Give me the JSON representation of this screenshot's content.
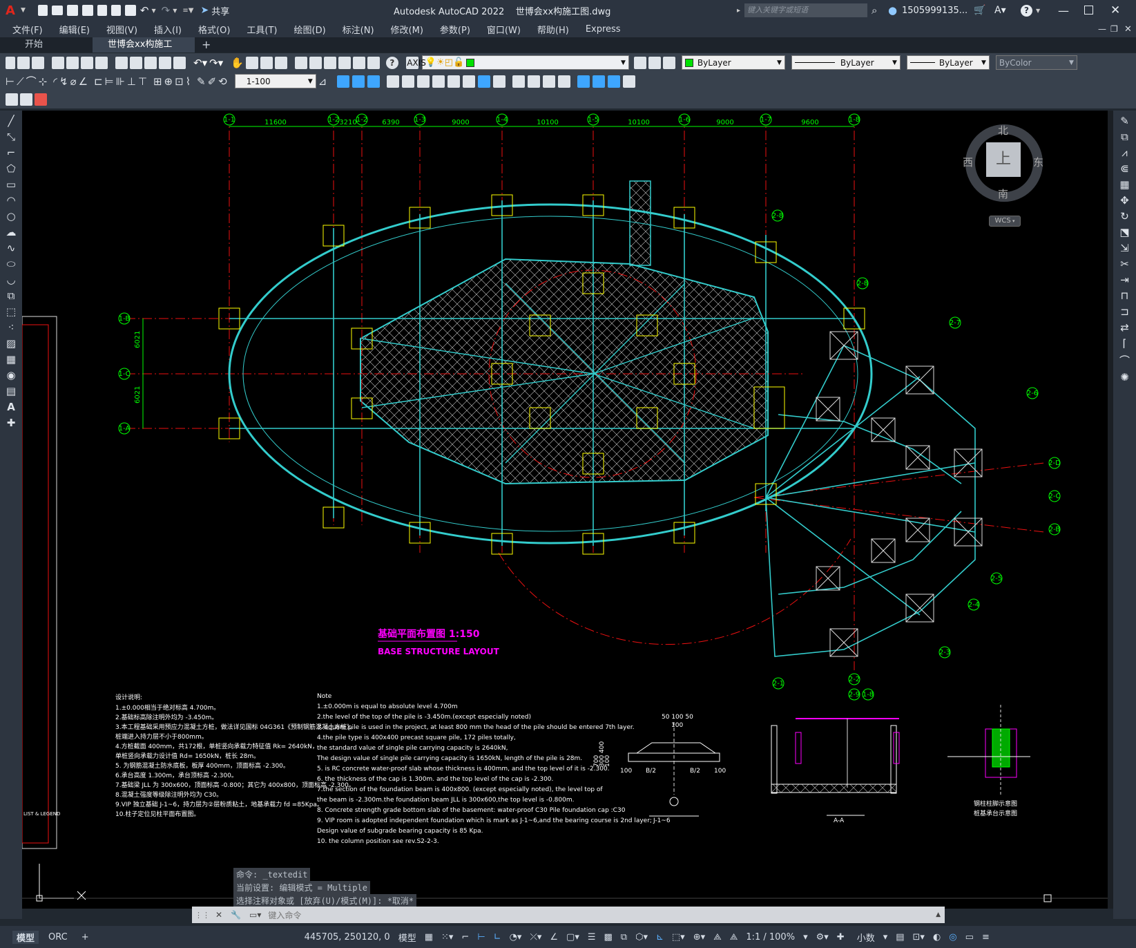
{
  "titlebar": {
    "logo": "A",
    "share_label": "共享",
    "title": "Autodesk AutoCAD 2022    世博会xx构施工图.dwg",
    "search_placeholder": "键入关键字或短语",
    "user": "1505999135...",
    "icons": [
      "new-icon",
      "open-icon",
      "save-icon",
      "saveas-icon",
      "publish-icon",
      "plot-icon",
      "undo-icon",
      "redo-icon",
      "share-icon",
      "search-icon",
      "user-icon",
      "cart-icon",
      "help-icon",
      "minimize-icon",
      "maximize-icon",
      "close-icon"
    ]
  },
  "menu": {
    "items": [
      "文件(F)",
      "编辑(E)",
      "视图(V)",
      "插入(I)",
      "格式(O)",
      "工具(T)",
      "绘图(D)",
      "标注(N)",
      "修改(M)",
      "参数(P)",
      "窗口(W)",
      "帮助(H)",
      "Express"
    ]
  },
  "tabs": {
    "items": [
      "开始",
      "世博会xx构施工图*"
    ],
    "add_label": "+"
  },
  "toolbar": {
    "layer_value": "AXIS",
    "color_value": "ByLayer",
    "linetype_value": "ByLayer",
    "lineweight_value": "ByLayer",
    "plotstyle_value": "ByColor",
    "scale_value": "1-100"
  },
  "viewcube": {
    "north": "北",
    "south": "南",
    "east": "东",
    "west": "西",
    "face": "上",
    "wcs": "WCS"
  },
  "drawing": {
    "title_cn": "基础平面布置图 1:150",
    "title_en": "BASE STRUCTURE LAYOUT",
    "grid_top": [
      "1-1",
      "1-2",
      "1-2",
      "1-3",
      "1-4",
      "1-5",
      "1-6",
      "1-7",
      "1-8"
    ],
    "dims_top": [
      "11600",
      "3210",
      "6390",
      "9000",
      "10100",
      "10100",
      "9000",
      "9600"
    ],
    "grid_left": [
      "1-B",
      "1-C",
      "1-A"
    ],
    "dims_left": [
      "6021",
      "6021"
    ],
    "grid_right": [
      "2-D",
      "2-C",
      "2-B"
    ],
    "grid_arc": [
      "2-8",
      "2-8",
      "2-7",
      "2-6",
      "2-5",
      "2-4",
      "2-3",
      "2-2",
      "2-1",
      "2-9",
      "1-8"
    ],
    "notes_cn_title": "设计说明:",
    "notes_cn": [
      "1.±0.000相当于绝对标高 4.700m。",
      "2.基础标高除注明外均为 -3.450m。",
      "3.本工程基础采用预应力混凝土方桩，做法详见国标 04G361《预制钢筋混凝土方桩》。",
      "   桩端进入持力层不小于800mm。",
      "4.方桩截面 400mm，共172根，单桩竖向承载力特征值 Rk= 2640kN，",
      "   单桩竖向承载力设计值 Rd= 1650kN，桩长 28m。",
      "5.      为钢筋混凝土防水底板，板厚 400mm，顶面标高 -2.300。",
      "6.承台高度 1.300m，承台顶标高 -2.300。",
      "7.基础梁 JLL 为 300x600，顶面标高 -0.800；其它为 400x800，顶面标高 -2.300。",
      "8.混凝土强度等级除注明外均为 C30。",
      "9.VIP 独立基础 J-1~6，持力层为②层粉质粘土，地基承载力 fd =85Kpa。",
      "10.柱子定位见柱平面布置图。"
    ],
    "notes_en_title": "Note",
    "notes_en": [
      "1.±0.000m is equal to absolute level 4.700m",
      "2.the level of the top of the pile is -3.450m.(except especially noted)",
      "3. square pile is used in the project, at least 800 mm the head of the pile should be entered 7th layer.",
      "4.the pile type is 400x400 precast square pile, 172 piles totally,",
      "the standard value of single pile carrying capacity is 2640kN,",
      "The design value of single pile carrying capacity is 1650kN, length of the pile is 28m.",
      "5.      is RC concrete water-proof slab whose thickness is 400mm, and the top level of it is -2.300.",
      "6. the thickness of the cap is 1.300m. and the top level of the cap is -2.300.",
      "7.the section of the foundation beam is 400x800. (except especially noted), the level top of",
      "the beam is -2.300m.the foundation beam JLL is 300x600,the top level is -0.800m.",
      "8. Concrete strength grade bottom slab of the basement: water-proof C30 Pile foundation cap :C30",
      "9. VIP room is adopted independent foundation which is mark as J-1~6,and the bearing course is 2nd layer;",
      "Design value of subgrade bearing capacity is 85 Kpa.",
      "10. the column position see rev.S2-2-3."
    ],
    "detail_labels": [
      "J-1~6",
      "A-A",
      "钢柱柱脚示意图",
      "桩基承台示意图"
    ],
    "detail_dims": [
      "50 100 50",
      "100",
      "100",
      "B/2",
      "B/2",
      "100",
      "100",
      "700",
      "300 400"
    ],
    "legend_label": "LIST & LEGEND"
  },
  "command": {
    "history": [
      "命令: _textedit",
      "当前设置: 编辑模式 = Multiple",
      "选择注释对象或 [放弃(U)/模式(M)]: *取消*"
    ],
    "prompt_placeholder": "键入命令"
  },
  "statusbar": {
    "layout_tabs": [
      "模型",
      "ORC"
    ],
    "add_layout": "+",
    "coords": "445705, 250120, 0",
    "space": "模型",
    "annotation_scale": "1:1 / 100%",
    "units": "小数"
  }
}
